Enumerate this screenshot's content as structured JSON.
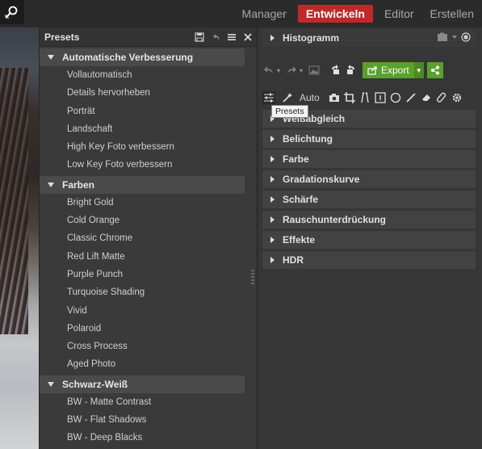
{
  "topbar": {
    "modes": [
      "Manager",
      "Entwickeln",
      "Editor",
      "Erstellen"
    ],
    "active_mode": "Entwickeln"
  },
  "presets": {
    "title": "Presets",
    "categories": [
      {
        "name": "Automatische Verbesserung",
        "items": [
          "Vollautomatisch",
          "Details hervorheben",
          "Porträt",
          "Landschaft",
          "High Key Foto verbessern",
          "Low Key Foto verbessern"
        ]
      },
      {
        "name": "Farben",
        "items": [
          "Bright Gold",
          "Cold Orange",
          "Classic Chrome",
          "Red Lift Matte",
          "Purple Punch",
          "Turquoise Shading",
          "Vivid",
          "Polaroid",
          "Cross Process",
          "Aged Photo"
        ]
      },
      {
        "name": "Schwarz-Weiß",
        "items": [
          "BW - Matte Contrast",
          "BW - Flat Shadows",
          "BW - Deep Blacks"
        ]
      }
    ]
  },
  "develop": {
    "histogram_label": "Histogramm",
    "export_label": "Export",
    "auto_label": "Auto",
    "tooltip": "Presets",
    "sections": [
      "Weißabgleich",
      "Belichtung",
      "Farbe",
      "Gradationskurve",
      "Schärfe",
      "Rauschunterdrückung",
      "Effekte",
      "HDR"
    ]
  },
  "colors": {
    "accent_red": "#c0282a",
    "export_green": "#5aa02c"
  }
}
